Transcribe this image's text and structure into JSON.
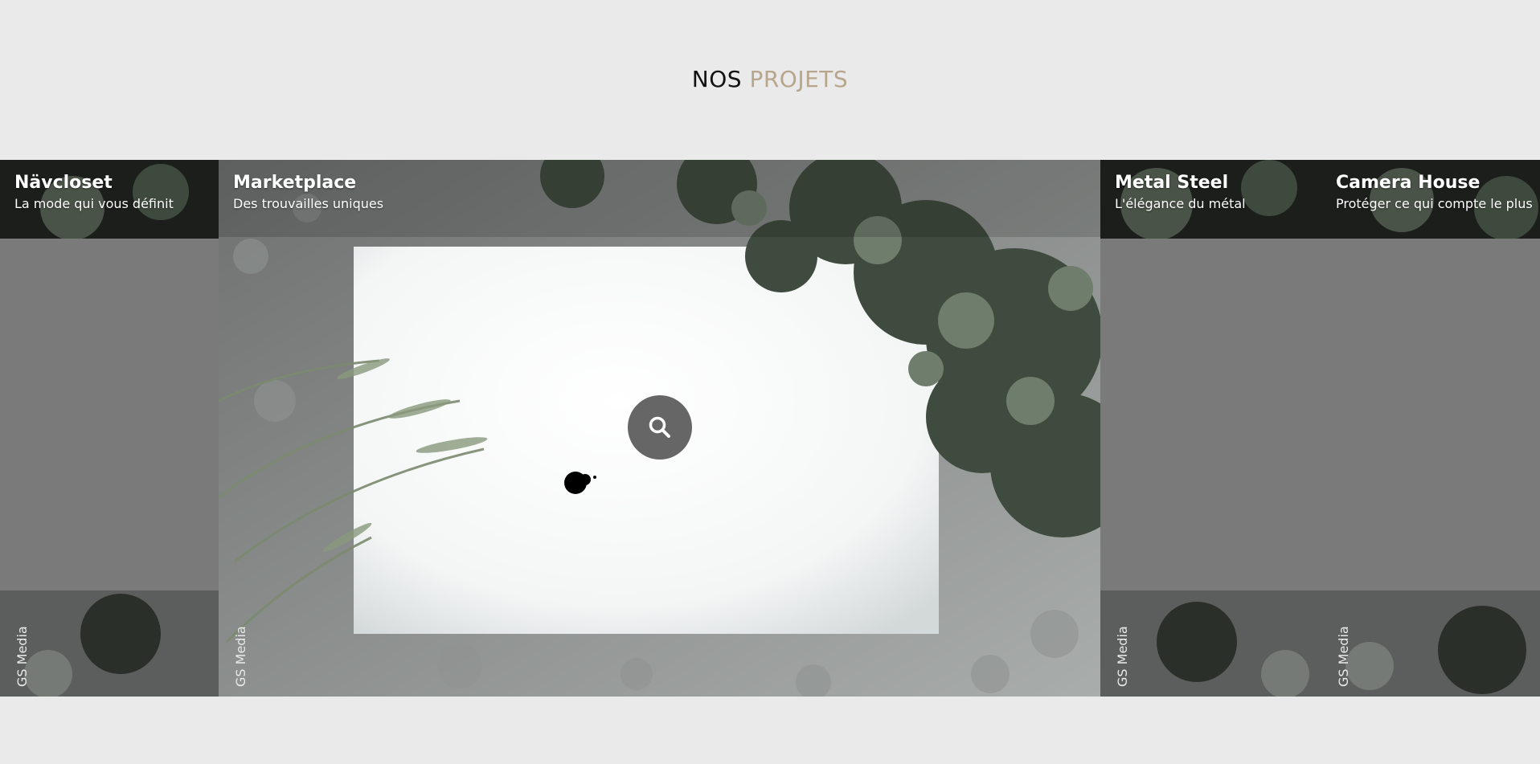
{
  "section": {
    "title_part1": "NOS",
    "title_part2": "PROJETS",
    "accent_color": "#b8a68c"
  },
  "projects": [
    {
      "title": "Nävcloset",
      "subtitle": "La mode qui vous définit",
      "tag": "GS Media",
      "active": false
    },
    {
      "title": "Marketplace",
      "subtitle": "Des trouvailles uniques",
      "tag": "GS Media",
      "active": true
    },
    {
      "title": "Metal Steel",
      "subtitle": "L'élégance du métal",
      "tag": "GS Media",
      "active": false
    },
    {
      "title": "Camera House",
      "subtitle": "Protéger ce qui compte le plus",
      "tag": "GS Media",
      "active": false
    }
  ],
  "zoom_button": {
    "icon": "search-icon"
  }
}
